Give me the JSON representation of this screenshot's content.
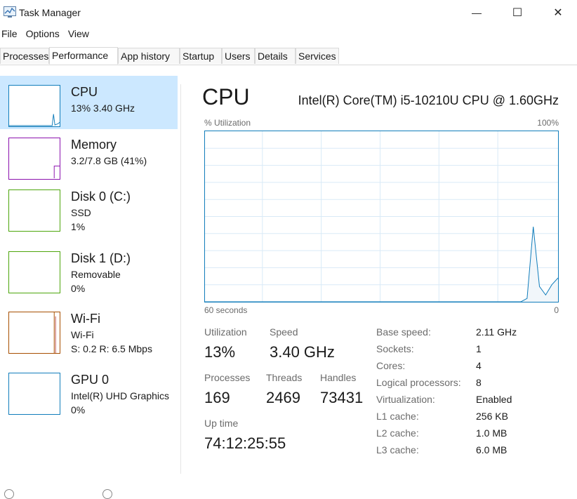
{
  "window": {
    "title": "Task Manager",
    "minimize": "—",
    "maximize": "☐",
    "close": "✕"
  },
  "menu": {
    "items": [
      "File",
      "Options",
      "View"
    ]
  },
  "tabs": [
    "Processes",
    "Performance",
    "App history",
    "Startup",
    "Users",
    "Details",
    "Services"
  ],
  "active_tab": "Performance",
  "sidebar": {
    "items": [
      {
        "title": "CPU",
        "line1": "13% 3.40 GHz",
        "line2": "",
        "color": "#117dbb",
        "selected": true
      },
      {
        "title": "Memory",
        "line1": "3.2/7.8 GB (41%)",
        "line2": "",
        "color": "#8b12ae"
      },
      {
        "title": "Disk 0 (C:)",
        "line1": "SSD",
        "line2": "1%",
        "color": "#4da60c"
      },
      {
        "title": "Disk 1 (D:)",
        "line1": "Removable",
        "line2": "0%",
        "color": "#4da60c"
      },
      {
        "title": "Wi-Fi",
        "line1": "Wi-Fi",
        "line2": "S: 0.2  R: 6.5 Mbps",
        "color": "#a74f01"
      },
      {
        "title": "GPU 0",
        "line1": "Intel(R) UHD Graphics",
        "line2": "0%",
        "color": "#117dbb"
      }
    ]
  },
  "main": {
    "title": "CPU",
    "cpu_name": "Intel(R) Core(TM) i5-10210U CPU @ 1.60GHz",
    "graph": {
      "y_label": "% Utilization",
      "y_max_label": "100%",
      "x_label": "60 seconds",
      "x_min_label": "0",
      "samples_percent": [
        0,
        0,
        0,
        0,
        0,
        0,
        0,
        0,
        0,
        0,
        0,
        0,
        0,
        0,
        0,
        0,
        0,
        0,
        0,
        0,
        0,
        0,
        0,
        0,
        0,
        0,
        0,
        0,
        0,
        0,
        0,
        0,
        0,
        0,
        0,
        0,
        0,
        0,
        0,
        0,
        0,
        0,
        0,
        0,
        0,
        0,
        0,
        0,
        0,
        0,
        0,
        0,
        2,
        44,
        9,
        4,
        10,
        14
      ]
    },
    "stats": {
      "utilization_label": "Utilization",
      "utilization": "13%",
      "speed_label": "Speed",
      "speed": "3.40 GHz",
      "processes_label": "Processes",
      "processes": "169",
      "threads_label": "Threads",
      "threads": "2469",
      "handles_label": "Handles",
      "handles": "73431",
      "uptime_label": "Up time",
      "uptime": "74:12:25:55"
    },
    "specs": [
      {
        "label": "Base speed:",
        "value": "2.11 GHz"
      },
      {
        "label": "Sockets:",
        "value": "1"
      },
      {
        "label": "Cores:",
        "value": "4"
      },
      {
        "label": "Logical processors:",
        "value": "8"
      },
      {
        "label": "Virtualization:",
        "value": "Enabled"
      },
      {
        "label": "L1 cache:",
        "value": "256 KB"
      },
      {
        "label": "L2 cache:",
        "value": "1.0 MB"
      },
      {
        "label": "L3 cache:",
        "value": "6.0 MB"
      }
    ]
  }
}
